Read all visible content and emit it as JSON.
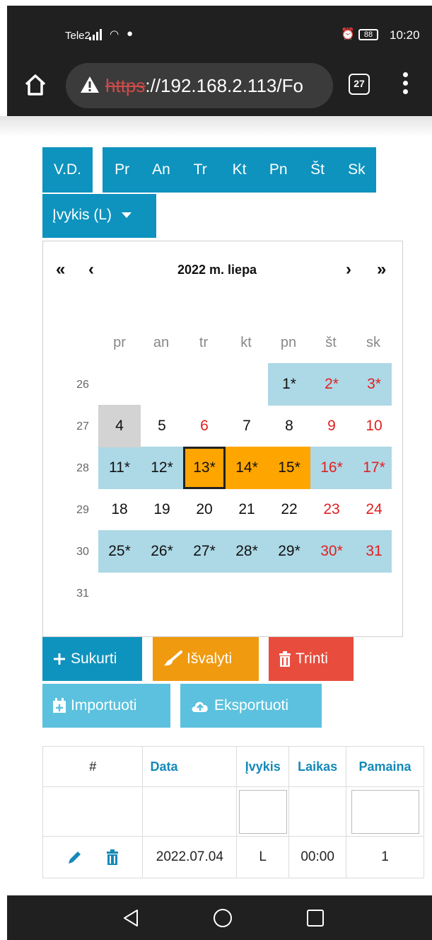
{
  "status_bar": {
    "carrier": "Tele2",
    "battery": "88",
    "time": "10:20"
  },
  "browser": {
    "url_scheme": "https",
    "url_rest": "://192.168.2.113/Fo",
    "tab_count": "27"
  },
  "toolbar": {
    "vd_label": "V.D.",
    "days": [
      "Pr",
      "An",
      "Tr",
      "Kt",
      "Pn",
      "Št",
      "Sk"
    ],
    "event_select": "Įvykis (L)"
  },
  "calendar": {
    "title": "2022 m. liepa",
    "nav": {
      "prev_year": "«",
      "prev_month": "‹",
      "next_month": "›",
      "next_year": "»"
    },
    "weekdays": [
      "pr",
      "an",
      "tr",
      "kt",
      "pn",
      "št",
      "sk"
    ],
    "weeks": [
      {
        "number": "26",
        "days": [
          "",
          "",
          "",
          "",
          "1*",
          "2*",
          "3*"
        ]
      },
      {
        "number": "27",
        "days": [
          "4",
          "5",
          "6",
          "7",
          "8",
          "9",
          "10"
        ]
      },
      {
        "number": "28",
        "days": [
          "11*",
          "12*",
          "13*",
          "14*",
          "15*",
          "16*",
          "17*"
        ]
      },
      {
        "number": "29",
        "days": [
          "18",
          "19",
          "20",
          "21",
          "22",
          "23",
          "24"
        ]
      },
      {
        "number": "30",
        "days": [
          "25*",
          "26*",
          "27*",
          "28*",
          "29*",
          "30*",
          "31"
        ]
      },
      {
        "number": "31",
        "days": [
          "",
          "",
          "",
          "",
          "",
          "",
          ""
        ]
      }
    ],
    "colors": {
      "event_band": "#add8e6",
      "range": "#ffa500",
      "today": "#d3d3d3",
      "weekend": "#e02020"
    }
  },
  "actions": {
    "create": "Sukurti",
    "clear": "Išvalyti",
    "delete": "Trinti",
    "import": "Importuoti",
    "export": "Eksportuoti"
  },
  "table": {
    "headers": [
      "#",
      "Data",
      "Įvykis",
      "Laikas",
      "Pamaina"
    ],
    "rows": [
      {
        "date": "2022.07.04",
        "event": "L",
        "time": "00:00",
        "shift": "1"
      }
    ]
  }
}
